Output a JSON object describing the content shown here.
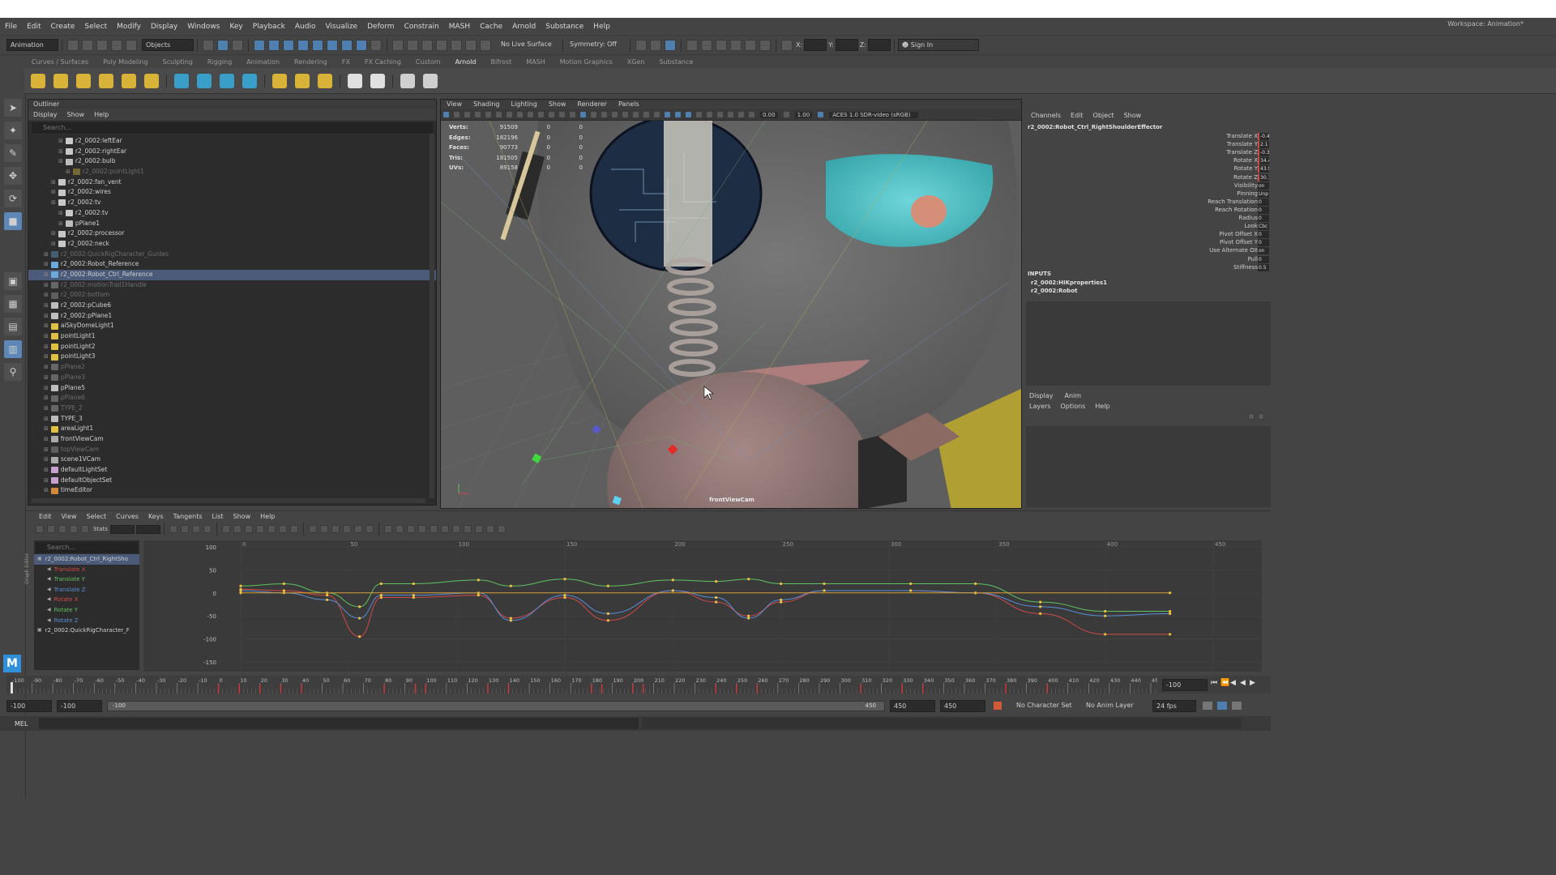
{
  "menubar": {
    "items": [
      "File",
      "Edit",
      "Create",
      "Select",
      "Modify",
      "Display",
      "Windows",
      "Key",
      "Playback",
      "Audio",
      "Visualize",
      "Deform",
      "Constrain",
      "MASH",
      "Cache",
      "Arnold",
      "Substance",
      "Help"
    ],
    "workspace_label": "Workspace:",
    "workspace_value": "Animation*"
  },
  "toolbar": {
    "mode": "Animation",
    "objects": "Objects",
    "live_surface": "No Live Surface",
    "symmetry": "Symmetry: Off",
    "x_label": "X:",
    "y_label": "Y:",
    "z_label": "Z:",
    "sign_in": "Sign In"
  },
  "shelf": {
    "tabs": [
      "Curves / Surfaces",
      "Poly Modeling",
      "Sculpting",
      "Rigging",
      "Animation",
      "Rendering",
      "FX",
      "FX Caching",
      "Custom",
      "Arnold",
      "Bifrost",
      "MASH",
      "Motion Graphics",
      "XGen",
      "Substance"
    ],
    "active_tab": "Arnold"
  },
  "outliner": {
    "title": "Outliner",
    "menu": [
      "Display",
      "Show",
      "Help"
    ],
    "search_placeholder": "Search...",
    "items": [
      {
        "label": "r2_0002:leftEar",
        "indent": 3,
        "dim": false,
        "icon": "mesh"
      },
      {
        "label": "r2_0002:rightEar",
        "indent": 3,
        "dim": false,
        "icon": "mesh"
      },
      {
        "label": "r2_0002:bulb",
        "indent": 3,
        "dim": false,
        "icon": "group"
      },
      {
        "label": "r2_0002:pointLight1",
        "indent": 4,
        "dim": true,
        "icon": "light"
      },
      {
        "label": "r2_0002:fan_vent",
        "indent": 2,
        "dim": false,
        "icon": "mesh"
      },
      {
        "label": "r2_0002:wires",
        "indent": 2,
        "dim": false,
        "icon": "mesh"
      },
      {
        "label": "r2_0002:tv",
        "indent": 2,
        "dim": false,
        "icon": "mesh"
      },
      {
        "label": "r2_0002:tv",
        "indent": 3,
        "dim": false,
        "icon": "mesh"
      },
      {
        "label": "pPlane1",
        "indent": 3,
        "dim": false,
        "icon": "group"
      },
      {
        "label": "r2_0002:processor",
        "indent": 2,
        "dim": false,
        "icon": "mesh"
      },
      {
        "label": "r2_0002:neck",
        "indent": 2,
        "dim": false,
        "icon": "mesh"
      },
      {
        "label": "r2_0002:QuickRigCharacter_Guides",
        "indent": 1,
        "dim": true,
        "icon": "joint"
      },
      {
        "label": "r2_0002:Robot_Reference",
        "indent": 1,
        "dim": false,
        "icon": "joint"
      },
      {
        "label": "r2_0002:Robot_Ctrl_Reference",
        "indent": 1,
        "dim": false,
        "icon": "joint",
        "selected": true
      },
      {
        "label": "r2_0002:motionTrail1Handle",
        "indent": 1,
        "dim": true,
        "icon": "group"
      },
      {
        "label": "r2_0002:bottom",
        "indent": 1,
        "dim": true,
        "icon": "camera"
      },
      {
        "label": "r2_0002:pCube6",
        "indent": 1,
        "dim": false,
        "icon": "group"
      },
      {
        "label": "r2_0002:pPlane1",
        "indent": 1,
        "dim": false,
        "icon": "group"
      },
      {
        "label": "aiSkyDomeLight1",
        "indent": 1,
        "dim": false,
        "icon": "light"
      },
      {
        "label": "pointLight1",
        "indent": 1,
        "dim": false,
        "icon": "light"
      },
      {
        "label": "pointLight2",
        "indent": 1,
        "dim": false,
        "icon": "light"
      },
      {
        "label": "pointLight3",
        "indent": 1,
        "dim": false,
        "icon": "light"
      },
      {
        "label": "pPlane2",
        "indent": 1,
        "dim": true,
        "icon": "group"
      },
      {
        "label": "pPlane3",
        "indent": 1,
        "dim": true,
        "icon": "group"
      },
      {
        "label": "pPlane5",
        "indent": 1,
        "dim": false,
        "icon": "group"
      },
      {
        "label": "pPlane6",
        "indent": 1,
        "dim": true,
        "icon": "group"
      },
      {
        "label": "TYPE_2",
        "indent": 1,
        "dim": true,
        "icon": "group"
      },
      {
        "label": "TYPE_3",
        "indent": 1,
        "dim": false,
        "icon": "group"
      },
      {
        "label": "areaLight1",
        "indent": 1,
        "dim": false,
        "icon": "light"
      },
      {
        "label": "frontViewCam",
        "indent": 1,
        "dim": false,
        "icon": "camera"
      },
      {
        "label": "topViewCam",
        "indent": 1,
        "dim": true,
        "icon": "camera"
      },
      {
        "label": "scene1VCam",
        "indent": 1,
        "dim": false,
        "icon": "camera"
      },
      {
        "label": "defaultLightSet",
        "indent": 1,
        "dim": false,
        "icon": "set"
      },
      {
        "label": "defaultObjectSet",
        "indent": 1,
        "dim": false,
        "icon": "set"
      },
      {
        "label": "timeEditor",
        "indent": 1,
        "dim": false,
        "icon": "editor"
      }
    ]
  },
  "viewport": {
    "menu": [
      "View",
      "Shading",
      "Lighting",
      "Show",
      "Renderer",
      "Panels"
    ],
    "exposure": "0.00",
    "gamma": "1.00",
    "colorspace": "ACES 1.0 SDR-video (sRGB)",
    "camera_label": "frontViewCam",
    "hud": [
      {
        "label": "Verts:",
        "v1": "91509",
        "v2": "0",
        "v3": "0"
      },
      {
        "label": "Edges:",
        "v1": "182196",
        "v2": "0",
        "v3": "0"
      },
      {
        "label": "Faces:",
        "v1": "90773",
        "v2": "0",
        "v3": "0"
      },
      {
        "label": "Tris:",
        "v1": "181505",
        "v2": "0",
        "v3": "0"
      },
      {
        "label": "UVs:",
        "v1": "89158",
        "v2": "0",
        "v3": "0"
      }
    ]
  },
  "channels": {
    "menu": [
      "Channels",
      "Edit",
      "Object",
      "Show"
    ],
    "node": "r2_0002:Robot_Ctrl_RightShoulderEffector",
    "attrs": [
      {
        "label": "Translate X",
        "value": "-0.4"
      },
      {
        "label": "Translate Y",
        "value": "2.1"
      },
      {
        "label": "Translate Z",
        "value": "-0.3"
      },
      {
        "label": "Rotate X",
        "value": "34.4"
      },
      {
        "label": "Rotate Y",
        "value": "43.9"
      },
      {
        "label": "Rotate Z",
        "value": "30.1"
      },
      {
        "label": "Visibility",
        "value": "on"
      },
      {
        "label": "Pinning",
        "value": "Unp"
      },
      {
        "label": "Reach Translation",
        "value": "0"
      },
      {
        "label": "Reach Rotation",
        "value": "0"
      },
      {
        "label": "Radius",
        "value": "0"
      },
      {
        "label": "Look",
        "value": "Cbc"
      },
      {
        "label": "Pivot Offset X",
        "value": "0"
      },
      {
        "label": "Pivot Offset Y",
        "value": "0"
      },
      {
        "label": "Use Alternate OX",
        "value": "on"
      },
      {
        "label": "Pull",
        "value": "0"
      },
      {
        "label": "Stiffness",
        "value": "0.5"
      }
    ],
    "inputs_title": "INPUTS",
    "inputs": [
      "r2_0002:HIKproperties1",
      "r2_0002:Robot"
    ]
  },
  "layers": {
    "tabs": [
      "Display",
      "Anim"
    ],
    "menu": [
      "Layers",
      "Options",
      "Help"
    ]
  },
  "grapheditor": {
    "side_label": "Graph Editor",
    "menu": [
      "Edit",
      "View",
      "Select",
      "Curves",
      "Keys",
      "Tangents",
      "List",
      "Show",
      "Help"
    ],
    "stats_label": "Stats",
    "search_placeholder": "Search...",
    "outline": [
      {
        "label": "r2_0002:Robot_Ctrl_RightSho",
        "color": "#cfcfcf",
        "selected": true
      },
      {
        "label": "Translate X",
        "color": "#d24a4a"
      },
      {
        "label": "Translate Y",
        "color": "#5ec25e"
      },
      {
        "label": "Translate Z",
        "color": "#5a8ed8"
      },
      {
        "label": "Rotate X",
        "color": "#d24a4a"
      },
      {
        "label": "Rotate Y",
        "color": "#5ec25e"
      },
      {
        "label": "Rotate Z",
        "color": "#5a8ed8"
      },
      {
        "label": "r2_0002:QuickRigCharacter_F",
        "color": "#cfcfcf"
      }
    ],
    "frame_ticks": [
      "0",
      "50",
      "100",
      "150",
      "200",
      "250",
      "300",
      "350",
      "400",
      "450"
    ],
    "value_ticks": [
      "100",
      "50",
      "0",
      "-50",
      "-100",
      "-150"
    ]
  },
  "timeline": {
    "ticks": [
      "-100",
      "-90",
      "-80",
      "-70",
      "-60",
      "-50",
      "-40",
      "-30",
      "-20",
      "-10",
      "0",
      "10",
      "20",
      "30",
      "40",
      "50",
      "60",
      "70",
      "80",
      "90",
      "100",
      "110",
      "120",
      "130",
      "140",
      "150",
      "160",
      "170",
      "180",
      "190",
      "200",
      "210",
      "220",
      "230",
      "240",
      "250",
      "260",
      "270",
      "280",
      "290",
      "300",
      "310",
      "320",
      "330",
      "340",
      "350",
      "360",
      "370",
      "380",
      "390",
      "400",
      "410",
      "420",
      "430",
      "440",
      "450"
    ],
    "current_frame": "-100",
    "range_start_outer": "-100",
    "range_start": "-100",
    "range_slider_start": "-100",
    "range_slider_end": "450",
    "range_end": "450",
    "range_end_outer": "450",
    "character_set": "No Character Set",
    "anim_layer": "No Anim Layer",
    "fps": "24 fps"
  },
  "cmdline": {
    "label": "MEL"
  }
}
